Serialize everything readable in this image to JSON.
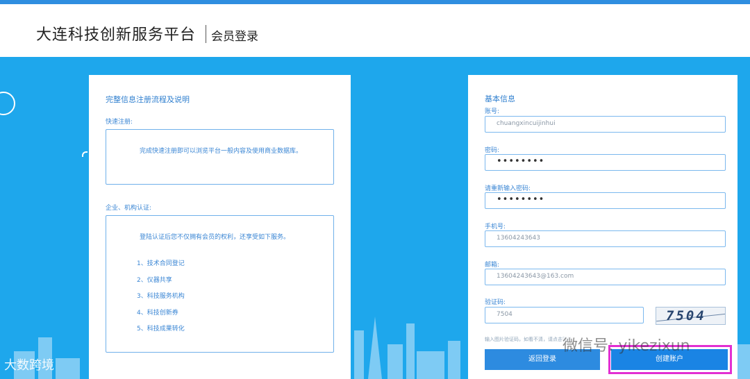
{
  "header": {
    "site_title": "大连科技创新服务平台",
    "page_subtitle": "会员登录"
  },
  "left_panel": {
    "title": "完整信息注册流程及说明",
    "quick_reg": {
      "label": "快速注册:",
      "desc": "完成快速注册即可以浏览平台一般内容及使用商业数据库。"
    },
    "org_cert": {
      "label": "企业、机构认证:",
      "desc": "登陆认证后您不仅拥有会员的权利，还享受如下服务。",
      "items": [
        "1、技术合同登记",
        "2、仪器共享",
        "3、科技服务机构",
        "4、科技创新券",
        "5、科技成果转化"
      ]
    }
  },
  "form": {
    "section_title": "基本信息",
    "account_label": "账号:",
    "account_value": "chuangxincuijinhui",
    "password_label": "密码:",
    "password_value": "••••••••",
    "confirm_label": "请重新输入密码:",
    "confirm_value": "••••••••",
    "phone_label": "手机号:",
    "phone_value": "13604243643",
    "email_label": "邮箱:",
    "email_value": "13604243643@163.com",
    "captcha_label": "验证码:",
    "captcha_value": "7504",
    "captcha_image_text": "7504",
    "hint": "输入图片验证码，如看不清，请点击图片"
  },
  "buttons": {
    "back_label": "返回登录",
    "create_label": "创建账户"
  },
  "watermarks": {
    "wechat": "微信号: yikezixun",
    "brand": "大数跨境"
  },
  "colors": {
    "brand_blue": "#1ea7ec",
    "button_blue": "#2d8be0",
    "highlight": "#e22fd2"
  }
}
